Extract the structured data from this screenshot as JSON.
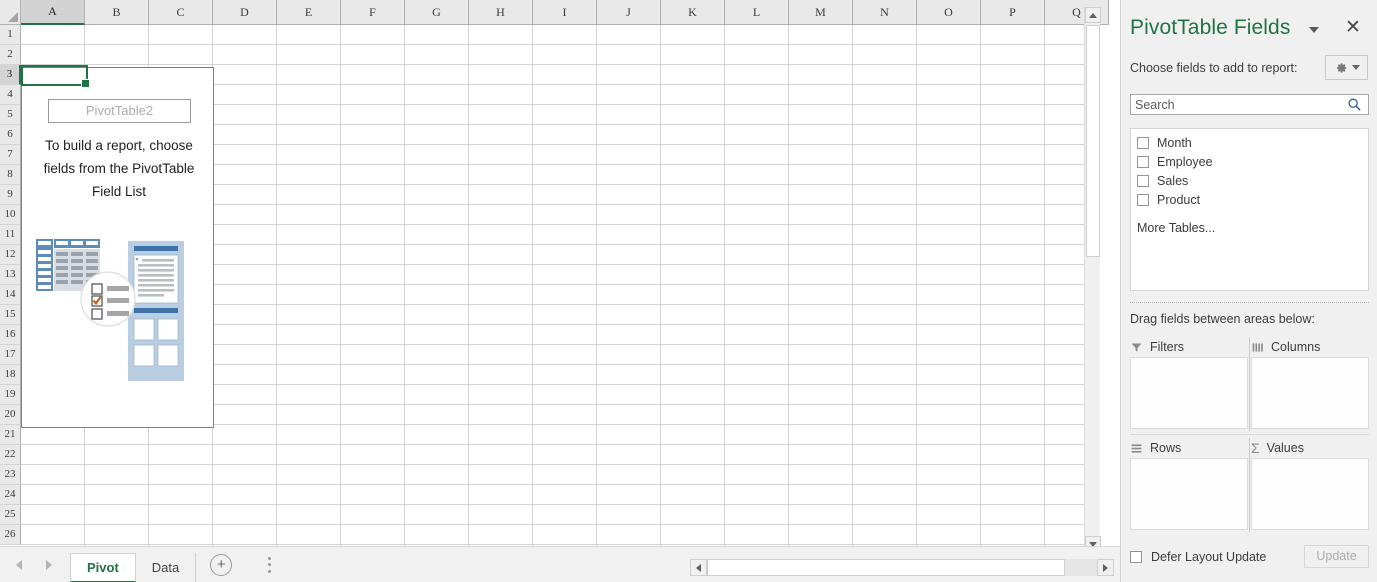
{
  "grid": {
    "columns": [
      "A",
      "B",
      "C",
      "D",
      "E",
      "F",
      "G",
      "H",
      "I",
      "J",
      "K",
      "L",
      "M",
      "N",
      "O",
      "P",
      "Q"
    ],
    "selected_column": "A",
    "rows": [
      1,
      2,
      3,
      4,
      5,
      6,
      7,
      8,
      9,
      10,
      11,
      12,
      13,
      14,
      15,
      16,
      17,
      18,
      19,
      20,
      21,
      22,
      23,
      24,
      25,
      26
    ],
    "selected_row": 3,
    "active_cell": "A3"
  },
  "pivot_placeholder": {
    "name": "PivotTable2",
    "message": "To build a report, choose fields from the PivotTable Field List"
  },
  "sheet_bar": {
    "prev_icon": "triangle-left-icon",
    "next_icon": "triangle-right-icon",
    "tabs": [
      {
        "label": "Pivot",
        "active": true
      },
      {
        "label": "Data",
        "active": false
      }
    ],
    "add_sheet_label": "+"
  },
  "panel": {
    "title": "PivotTable Fields",
    "caret_icon": "chevron-down-icon",
    "close_icon": "close-icon",
    "choose_label": "Choose fields to add to report:",
    "gear_icon": "gear-icon",
    "gear_caret_icon": "chevron-down-icon",
    "search": {
      "placeholder": "Search",
      "value": "",
      "icon": "search-icon"
    },
    "fields": [
      {
        "label": "Month",
        "checked": false
      },
      {
        "label": "Employee",
        "checked": false
      },
      {
        "label": "Sales",
        "checked": false
      },
      {
        "label": "Product",
        "checked": false
      }
    ],
    "more_tables": "More Tables...",
    "drag_label": "Drag fields between areas below:",
    "areas": [
      {
        "label": "Filters",
        "icon": "filter-icon",
        "items": []
      },
      {
        "label": "Columns",
        "icon": "columns-icon",
        "items": []
      },
      {
        "label": "Rows",
        "icon": "rows-icon",
        "items": []
      },
      {
        "label": "Values",
        "icon": "sigma-icon",
        "items": []
      }
    ],
    "defer": {
      "label": "Defer Layout Update",
      "checked": false,
      "update_label": "Update",
      "update_enabled": false
    }
  },
  "colors": {
    "accent_green": "#217346",
    "panel_bg": "#f0f0f0",
    "grid_line": "#d4d4d4",
    "illustration_blue": "#4a7ebb",
    "check_orange": "#c55a11"
  }
}
